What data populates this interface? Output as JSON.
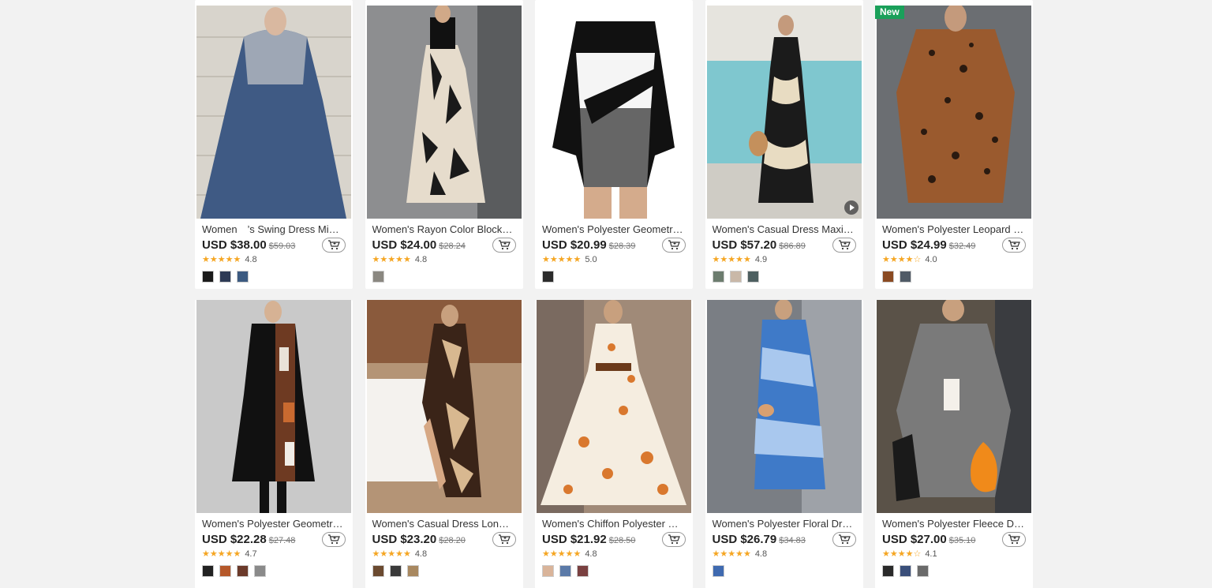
{
  "products": [
    {
      "title": "Women　’s Swing Dress Midi Dress",
      "price": "USD $38.00",
      "orig": "$59.03",
      "stars": "★★★★★",
      "rating": "4.8",
      "badge": "",
      "swatches": [
        "#1a1a1a",
        "#2d3a55",
        "#3c5a80"
      ]
    },
    {
      "title": "Women's Rayon Color Block Maxi Dress",
      "price": "USD $24.00",
      "orig": "$28.24",
      "stars": "★★★★★",
      "rating": "4.8",
      "badge": "",
      "swatches": [
        "#8a8780"
      ]
    },
    {
      "title": "Women's Polyester Geometric Dress",
      "price": "USD $20.99",
      "orig": "$28.39",
      "stars": "★★★★★",
      "rating": "5.0",
      "badge": "",
      "swatches": [
        "#2b2b2b"
      ]
    },
    {
      "title": "Women's Casual Dress Maxi Dress",
      "price": "USD $57.20",
      "orig": "$86.89",
      "stars": "★★★★★",
      "rating": "4.9",
      "badge": "",
      "swatches": [
        "#6c7c6e",
        "#c9b8a8",
        "#4d5f60"
      ]
    },
    {
      "title": "Women's Polyester Leopard Dress",
      "price": "USD $24.99",
      "orig": "$32.49",
      "stars": "★★★★☆",
      "rating": "4.0",
      "badge": "New",
      "swatches": [
        "#8a4a22",
        "#505a66"
      ]
    },
    {
      "title": "Women's Polyester Geometric Dress",
      "price": "USD $22.28",
      "orig": "$27.48",
      "stars": "★★★★★",
      "rating": "4.7",
      "badge": "",
      "swatches": [
        "#222222",
        "#b5582a",
        "#6b3a2a",
        "#8a8a8a"
      ]
    },
    {
      "title": "Women's Casual Dress Long Dress",
      "price": "USD $23.20",
      "orig": "$28.20",
      "stars": "★★★★★",
      "rating": "4.8",
      "badge": "",
      "swatches": [
        "#6b4a30",
        "#3a3a3a",
        "#a88860"
      ]
    },
    {
      "title": "Women's Chiffon Polyester Dress",
      "price": "USD $21.92",
      "orig": "$28.50",
      "stars": "★★★★★",
      "rating": "4.8",
      "badge": "",
      "swatches": [
        "#d9b49a",
        "#5b7aa8",
        "#7a4040"
      ]
    },
    {
      "title": "Women's Polyester Floral Dress",
      "price": "USD $26.79",
      "orig": "$34.83",
      "stars": "★★★★★",
      "rating": "4.8",
      "badge": "",
      "swatches": [
        "#3f6ab0"
      ]
    },
    {
      "title": "Women's Polyester Fleece Dress",
      "price": "USD $27.00",
      "orig": "$35.10",
      "stars": "★★★★☆",
      "rating": "4.1",
      "badge": "",
      "swatches": [
        "#2a2a2a",
        "#3a4f7a",
        "#6a6a6a"
      ]
    }
  ],
  "icons": {
    "cart": "cart-plus-icon",
    "play": "play-icon",
    "star": "star-icon"
  },
  "colors": {
    "star": "#f5a623",
    "badge": "#1aa05a",
    "background": "#f2f2f2"
  }
}
